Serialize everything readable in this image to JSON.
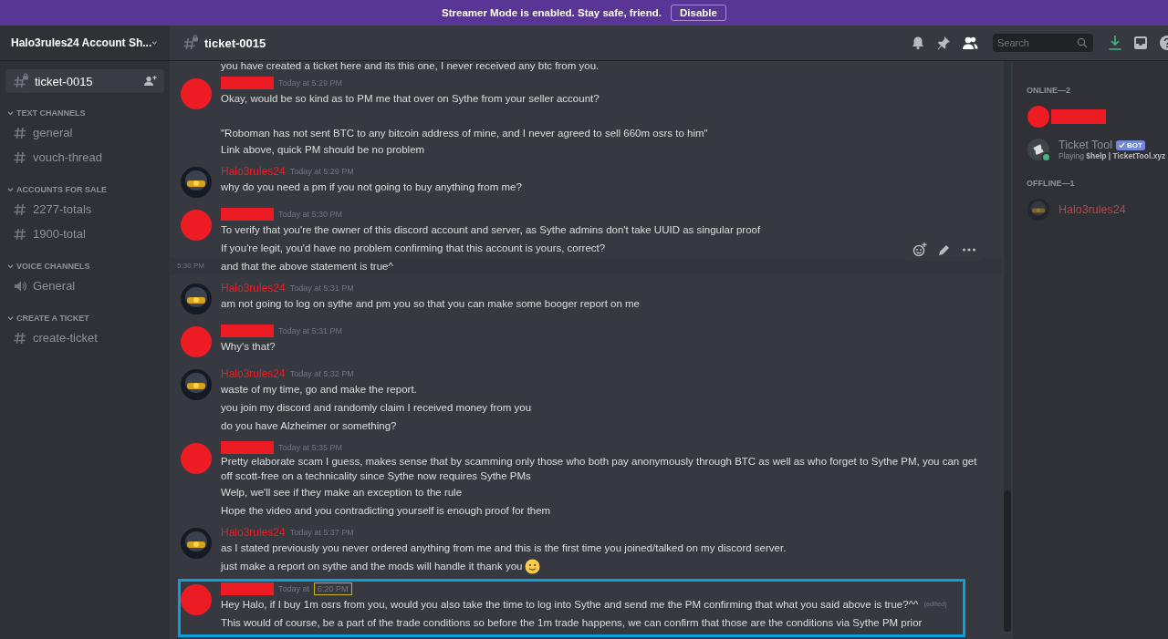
{
  "banner": {
    "text": "Streamer Mode is enabled. Stay safe, friend.",
    "button": "Disable"
  },
  "sidebar": {
    "server_name": "Halo3rules24 Account Sh...",
    "pinned_channel": {
      "name": "ticket-0015",
      "selected": true
    },
    "categories": [
      {
        "name": "TEXT CHANNELS",
        "channels": [
          {
            "name": "general",
            "kind": "text"
          },
          {
            "name": "vouch-thread",
            "kind": "text"
          }
        ]
      },
      {
        "name": "ACCOUNTS FOR SALE",
        "channels": [
          {
            "name": "2277-totals",
            "kind": "text"
          },
          {
            "name": "1900-total",
            "kind": "text"
          }
        ]
      },
      {
        "name": "VOICE CHANNELS",
        "channels": [
          {
            "name": "General",
            "kind": "voice"
          }
        ]
      },
      {
        "name": "CREATE A TICKET",
        "channels": [
          {
            "name": "create-ticket",
            "kind": "text"
          }
        ]
      }
    ]
  },
  "header": {
    "channel": "ticket-0015",
    "search": {
      "placeholder": "Search"
    }
  },
  "messages": {
    "cut_line": "you have created a ticket here and its this one, I never received any btc from you.",
    "groups": [
      {
        "author": {
          "kind": "redacted"
        },
        "time": "Today at 5:29 PM",
        "time_highlighted": false,
        "highlighted": false,
        "lines": [
          {
            "text": "Okay, would be so kind as to PM me that over on Sythe from your seller account?",
            "spaced": false,
            "hovered": false
          },
          {
            "text": "\"Roboman has not sent BTC to any bitcoin address of mine, and I never agreed to sell 660m osrs to him\"",
            "spaced": true,
            "hovered": false
          },
          {
            "text": "Link above, quick PM should be no problem",
            "spaced": false,
            "hovered": false
          }
        ]
      },
      {
        "author": {
          "kind": "user",
          "name": "Halo3rules24"
        },
        "time": "Today at 5:29 PM",
        "time_highlighted": false,
        "highlighted": false,
        "lines": [
          {
            "text": "why do you need a pm if you not going to buy anything from me?",
            "spaced": false,
            "hovered": false
          }
        ]
      },
      {
        "author": {
          "kind": "redacted"
        },
        "time": "Today at 5:30 PM",
        "time_highlighted": false,
        "highlighted": false,
        "lines": [
          {
            "text": "To verify that you're the owner of this discord account and server, as Sythe admins don't take UUID as singular proof",
            "spaced": false,
            "hovered": false
          },
          {
            "text": "If you're legit, you'd have no problem confirming that this account is yours, correct?",
            "spaced": false,
            "hovered": false
          },
          {
            "text": "and that the above statement is true^",
            "spaced": false,
            "hovered": true,
            "hover_time": "5:30 PM"
          }
        ]
      },
      {
        "author": {
          "kind": "user",
          "name": "Halo3rules24"
        },
        "time": "Today at 5:31 PM",
        "time_highlighted": false,
        "highlighted": false,
        "lines": [
          {
            "text": "am not going to log on sythe and pm you so that you can make some booger report on me",
            "spaced": false,
            "hovered": false
          }
        ]
      },
      {
        "author": {
          "kind": "redacted"
        },
        "time": "Today at 5:31 PM",
        "time_highlighted": false,
        "highlighted": false,
        "lines": [
          {
            "text": "Why's that?",
            "spaced": false,
            "hovered": false
          }
        ]
      },
      {
        "author": {
          "kind": "user",
          "name": "Halo3rules24"
        },
        "time": "Today at 5:32 PM",
        "time_highlighted": false,
        "highlighted": false,
        "lines": [
          {
            "text": "waste of my time, go and make the report.",
            "spaced": false,
            "hovered": false
          },
          {
            "text": "you join my discord and randomly claim I received money from you",
            "spaced": false,
            "hovered": false
          },
          {
            "text": "do you have Alzheimer or something?",
            "spaced": false,
            "hovered": false
          }
        ]
      },
      {
        "author": {
          "kind": "redacted"
        },
        "time": "Today at 5:35 PM",
        "time_highlighted": false,
        "highlighted": false,
        "lines": [
          {
            "text": "Pretty elaborate scam I guess, makes sense that by scamming only those who both pay anonymously through BTC as well as who forget to Sythe PM, you can get off scott-free on a technicality since Sythe now requires Sythe PMs",
            "spaced": false,
            "hovered": false
          },
          {
            "text": "Welp, we'll see if they make an exception to the rule",
            "spaced": false,
            "hovered": false
          },
          {
            "text": "Hope the video and you contradicting yourself is enough proof for them",
            "spaced": false,
            "hovered": false
          }
        ]
      },
      {
        "author": {
          "kind": "user",
          "name": "Halo3rules24"
        },
        "time": "Today at 5:37 PM",
        "time_highlighted": false,
        "highlighted": false,
        "lines": [
          {
            "text": "as I stated previously you never ordered anything from me and this is the first time you joined/talked on my discord server.",
            "spaced": false,
            "hovered": false
          },
          {
            "text": "just make a report on sythe and the mods will handle it thank you",
            "spaced": false,
            "hovered": false,
            "emoji": true
          }
        ]
      },
      {
        "author": {
          "kind": "redacted"
        },
        "time": "Today at",
        "time_extra": "6:20 PM",
        "time_highlighted": true,
        "highlighted": true,
        "lines": [
          {
            "text": "Hey Halo, if I buy 1m osrs from you, would you also take the time to log into Sythe and send me the PM confirming that what you said above is true?^^",
            "spaced": false,
            "hovered": false,
            "edited": "(edited)"
          },
          {
            "text": "This would of course, be a part of the trade conditions so before the 1m trade happens, we can confirm that those are the conditions via Sythe PM prior",
            "spaced": false,
            "hovered": false
          }
        ]
      }
    ]
  },
  "members": {
    "sections": [
      {
        "title": "ONLINE—2",
        "members": [
          {
            "kind": "redacted"
          },
          {
            "kind": "bot",
            "name": "Ticket Tool",
            "badge": "BOT",
            "activity": "Playing **$help | TicketTool.xyz**",
            "online": true
          }
        ]
      },
      {
        "title": "OFFLINE—1",
        "members": [
          {
            "kind": "user",
            "name": "Halo3rules24",
            "online": false
          }
        ]
      }
    ]
  }
}
